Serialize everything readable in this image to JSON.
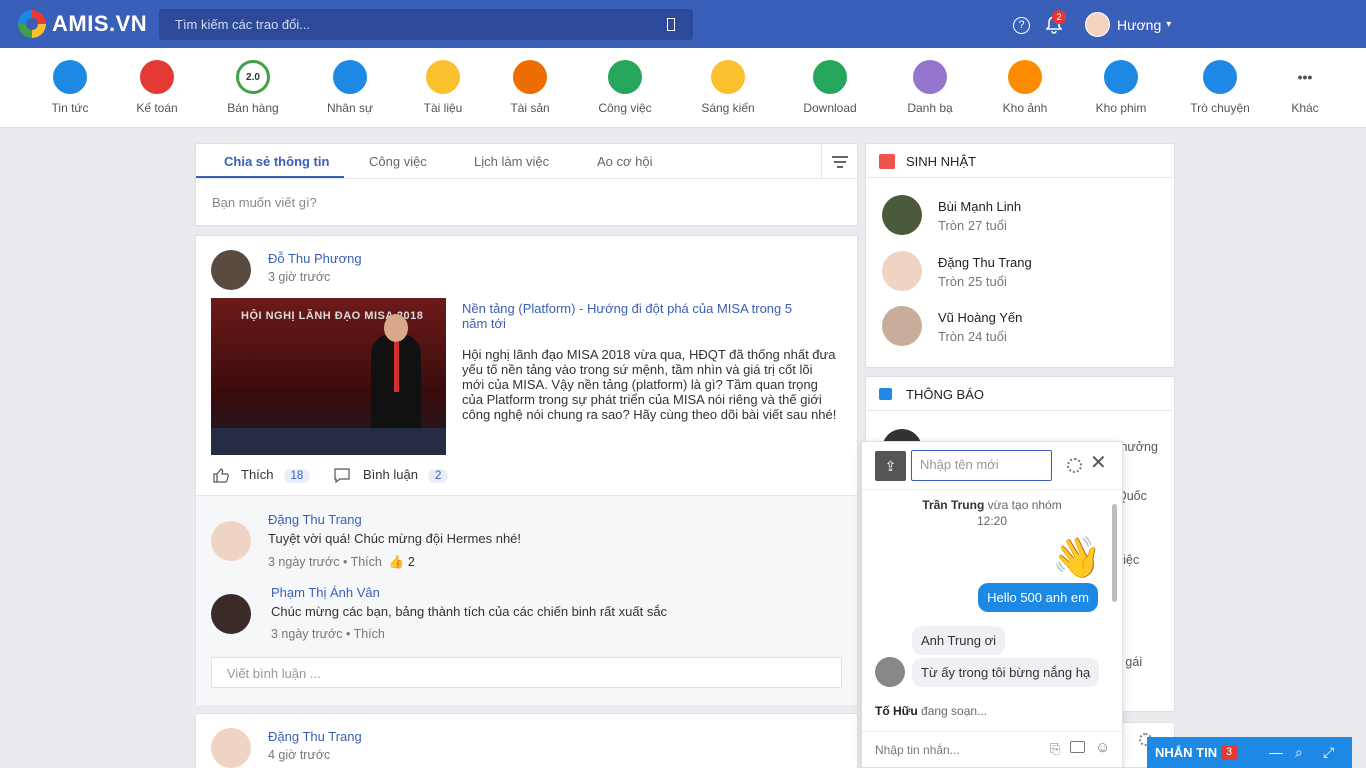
{
  "header": {
    "logo_text": "AMIS.VN",
    "search_placeholder": "Tìm kiếm các trao đổi...",
    "notification_count": "2",
    "user_name": "Hương"
  },
  "apps": [
    {
      "label": "Tin tức",
      "color": "#1e88e5"
    },
    {
      "label": "Kế toán",
      "color": "#e53935"
    },
    {
      "label": "Bán hàng",
      "color": "#43a047",
      "icon_text": "2.0"
    },
    {
      "label": "Nhân sự",
      "color": "#1e88e5"
    },
    {
      "label": "Tài liệu",
      "color": "#fbc02d"
    },
    {
      "label": "Tài sản",
      "color": "#ef6c00"
    },
    {
      "label": "Công việc",
      "color": "#26a65b"
    },
    {
      "label": "Sáng kiến",
      "color": "#fbc02d"
    },
    {
      "label": "Download",
      "color": "#26a65b"
    },
    {
      "label": "Danh bạ",
      "color": "#9575cd"
    },
    {
      "label": "Kho ảnh",
      "color": "#fb8c00"
    },
    {
      "label": "Kho phim",
      "color": "#1e88e5"
    },
    {
      "label": "Trò chuyện",
      "color": "#1e88e5"
    },
    {
      "label": "Khác",
      "color": "#555555"
    }
  ],
  "composer": {
    "tabs": [
      "Chia sẻ thông tin",
      "Công việc",
      "Lịch làm việc",
      "Ao cơ hội"
    ],
    "placeholder": "Bạn muốn viết gì?"
  },
  "post1": {
    "author": "Đỗ Thu Phương",
    "time": "3 giờ trước",
    "image_heading": "HỘI NGHỊ LÃNH ĐẠO MISA 2018",
    "title": "Nền tảng (Platform) - Hướng đi đột phá của MISA trong 5 năm tới",
    "body": "Hội nghị lãnh đạo MISA 2018 vừa qua, HĐQT đã thống nhất đưa yếu tố nền tảng vào trong sứ mệnh, tầm nhìn và giá trị cốt lõi mới của MISA. Vậy nền tảng (platform) là gì? Tầm quan trọng của Platform trong sự phát triển của MISA nói riêng và thế giới công nghệ nói chung ra sao? Hãy cùng theo dõi bài viết sau nhé!",
    "like_label": "Thích",
    "like_count": "18",
    "comment_label": "Bình luận",
    "comment_count": "2",
    "comments": [
      {
        "author": "Đặng Thu Trang",
        "text": "Tuyệt vời quá! Chúc mừng đội Hermes nhé!",
        "time": "3 ngày trước",
        "like": "Thích",
        "likes": "2"
      },
      {
        "author": "Phạm Thị Ánh Vân",
        "text": "Chúc mừng các bạn, bảng thành tích của các chiến binh rất xuất sắc",
        "time": "3 ngày trước",
        "like": "Thích"
      }
    ],
    "comment_placeholder": "Viết bình luận ..."
  },
  "post2": {
    "author": "Đặng Thu Trang",
    "time": "4 giờ trước"
  },
  "birthday": {
    "title": "SINH NHẬT",
    "people": [
      {
        "name": "Bùi Mạnh Linh",
        "age": "Tròn 27 tuổi"
      },
      {
        "name": "Đặng Thu Trang",
        "age": "Tròn 25 tuổi"
      },
      {
        "name": "Vũ Hoàng Yến",
        "age": "Tròn 24 tuổi"
      }
    ]
  },
  "notices": {
    "title": "THÔNG BÁO",
    "fragments": [
      "thưởng",
      "Quốc",
      "việc",
      "ế gái"
    ]
  },
  "chat": {
    "name_placeholder": "Nhập tên mới",
    "system_author": "Trần Trung",
    "system_text": "vừa tạo nhóm",
    "system_time": "12:20",
    "wave": "👋",
    "out_message": "Hello 500 anh em",
    "in_messages": [
      "Anh Trung ơi",
      "Từ ấy trong tôi bừng nắng hạ"
    ],
    "typing_name": "Tố Hữu",
    "typing_text": "đang soạn...",
    "input_placeholder": "Nhập tin nhắn..."
  },
  "messenger": {
    "label": "NHẮN TIN",
    "count": "3"
  }
}
